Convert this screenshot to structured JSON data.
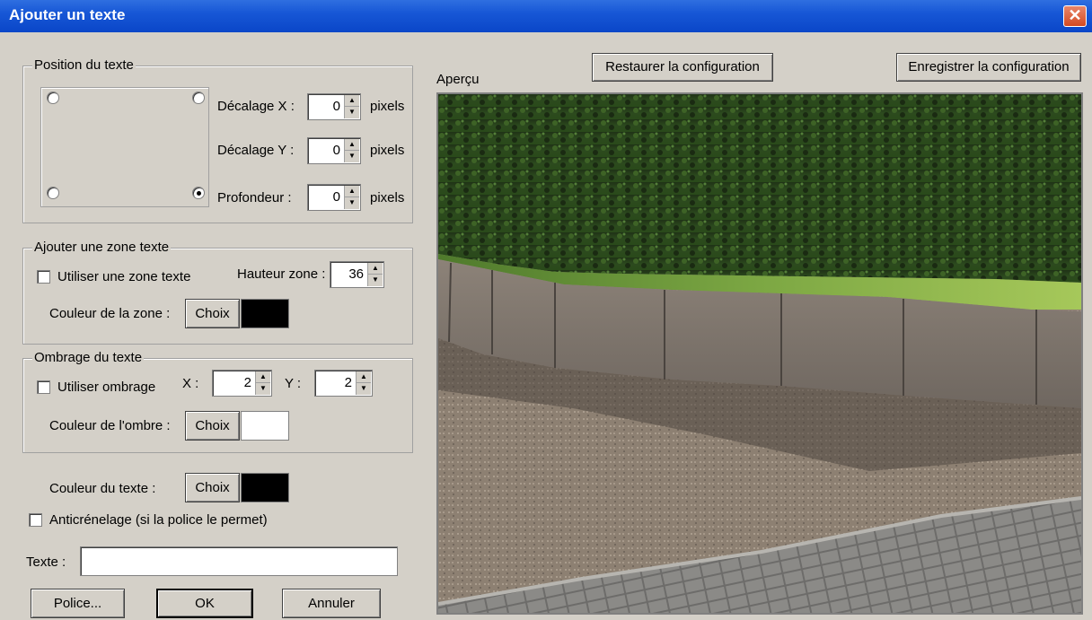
{
  "window": {
    "title": "Ajouter un texte",
    "close_label": "✕"
  },
  "position": {
    "legend": "Position du texte",
    "offset_x_label": "Décalage X :",
    "offset_x_value": "0",
    "offset_x_unit": "pixels",
    "offset_y_label": "Décalage Y :",
    "offset_y_value": "0",
    "offset_y_unit": "pixels",
    "depth_label": "Profondeur :",
    "depth_value": "0",
    "depth_unit": "pixels",
    "selected_anchor": "bottom-right"
  },
  "zone": {
    "legend": "Ajouter une zone texte",
    "use_label": "Utiliser une zone texte",
    "use_checked": false,
    "height_label": "Hauteur zone :",
    "height_value": "36",
    "color_label": "Couleur de la zone :",
    "choose_label": "Choix",
    "color": "#000000"
  },
  "shadow": {
    "legend": "Ombrage du texte",
    "use_label": "Utiliser ombrage",
    "use_checked": false,
    "x_label": "X :",
    "x_value": "2",
    "y_label": "Y :",
    "y_value": "2",
    "color_label": "Couleur de l'ombre :",
    "choose_label": "Choix",
    "color": "#ffffff"
  },
  "text_color": {
    "label": "Couleur du texte :",
    "choose_label": "Choix",
    "color": "#000000"
  },
  "antialias": {
    "label": "Anticrénelage (si la police le permet)",
    "checked": false
  },
  "text": {
    "label": "Texte :",
    "value": ""
  },
  "buttons": {
    "font": "Police...",
    "ok": "OK",
    "cancel": "Annuler",
    "restore": "Restaurer la configuration",
    "save": "Enregistrer  la configuration"
  },
  "preview": {
    "label": "Aperçu"
  }
}
